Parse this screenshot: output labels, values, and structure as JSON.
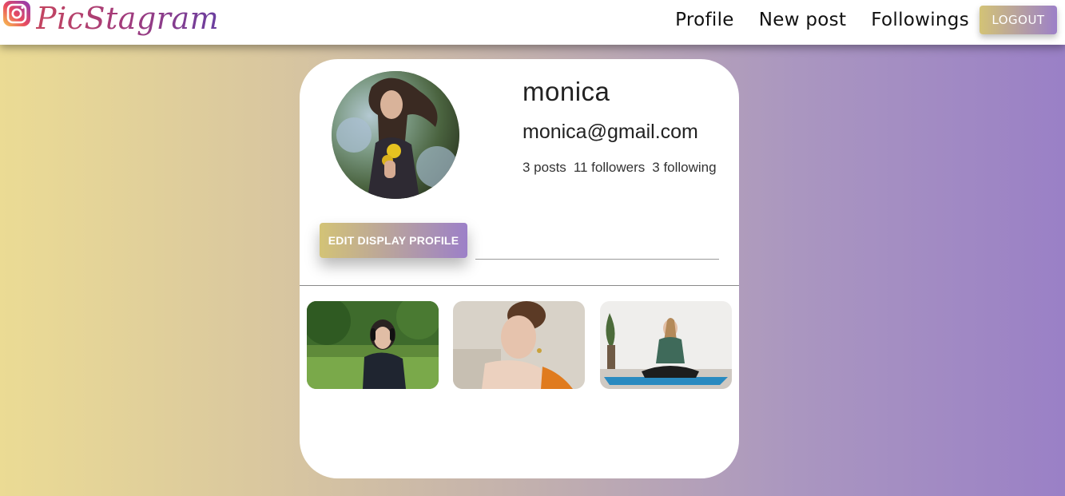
{
  "brand": {
    "name": "PicStagram",
    "icon": "instagram-logo-icon"
  },
  "nav": {
    "links": [
      "Profile",
      "New post",
      "Followings"
    ],
    "logout_label": "LOGOUT"
  },
  "profile": {
    "username": "monica",
    "email": "monica@gmail.com",
    "stats": {
      "posts": "3 posts",
      "followers": "11 followers",
      "following": "3 following"
    },
    "edit_label": "EDIT DISPLAY PROFILE",
    "avatar": "profile-photo-woman-with-yellow-flowers"
  },
  "posts": [
    {
      "description": "woman-with-headphones-on-grass"
    },
    {
      "description": "woman-portrait-with-earrings"
    },
    {
      "description": "woman-meditating-on-yoga-mat"
    }
  ],
  "colors": {
    "gradient_start": "#ebdb94",
    "gradient_end": "#9a80c6",
    "button_gradient_start": "#d3c376",
    "button_gradient_end": "#9c80c8"
  }
}
